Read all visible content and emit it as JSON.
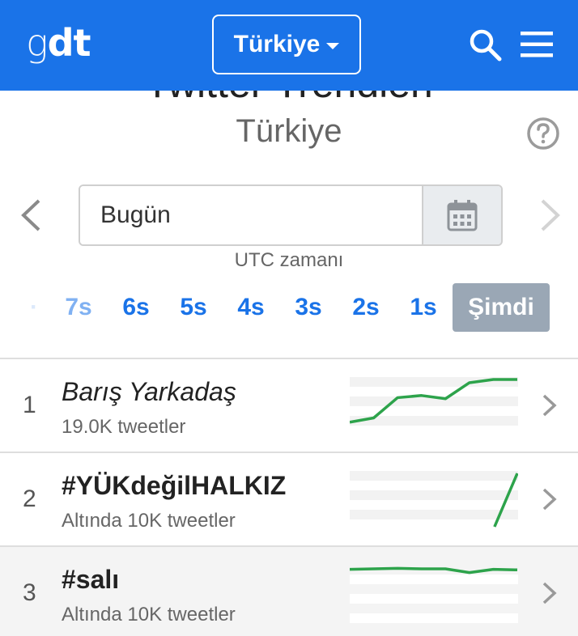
{
  "header": {
    "logo_light": "g",
    "logo_bold": "dt",
    "country_button": "Türkiye",
    "brand_color": "#1a73e8",
    "icons": [
      "search-icon",
      "hamburger-menu-icon"
    ]
  },
  "page": {
    "heading": "Twitter Trendleri",
    "country": "Türkiye",
    "help_icon": "question-circle-icon"
  },
  "date_picker": {
    "value": "Bugün",
    "note": "UTC zamanı",
    "icons": [
      "chevron-left-icon",
      "calendar-icon",
      "chevron-right-icon"
    ]
  },
  "hours": [
    "7s",
    "6s",
    "5s",
    "4s",
    "3s",
    "2s",
    "1s"
  ],
  "hours_now": "Şimdi",
  "trends": [
    {
      "rank": "1",
      "name": "Barış Yarkadaş",
      "count": "19.0K tweetler",
      "spark": [
        0.2,
        0.28,
        0.66,
        0.7,
        0.64,
        0.94,
        1.0,
        1.0
      ]
    },
    {
      "rank": "2",
      "name": "#YÜKdeğilHALKIZ",
      "count": "Altında 10K tweetler",
      "spark": [
        0.0,
        1.0
      ]
    },
    {
      "rank": "3",
      "name": "#salı",
      "count": "Altında 10K tweetler",
      "spark": [
        0.96,
        0.97,
        0.98,
        0.97,
        0.97,
        0.9,
        0.96,
        0.95
      ]
    }
  ],
  "colors": {
    "spark_line": "#2da34b",
    "now_button": "#9aa7b5"
  }
}
